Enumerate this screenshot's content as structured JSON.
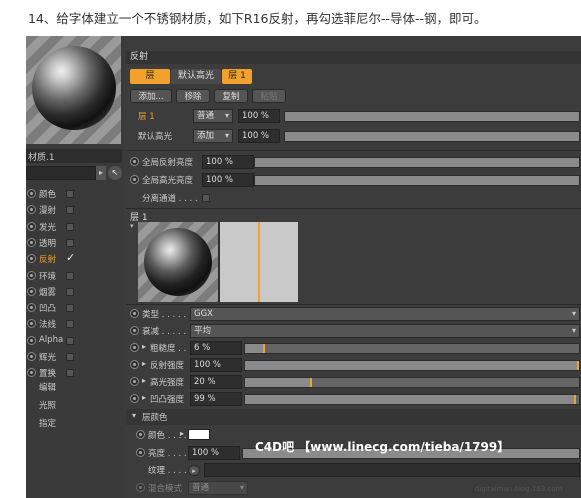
{
  "caption": "14、给字体建立一个不锈钢材质，如下R16反射，再勾选菲尼尔--导体--钢，即可。",
  "material_name": "材质.1",
  "channels": [
    {
      "label": "颜色",
      "active": false
    },
    {
      "label": "漫射",
      "active": false
    },
    {
      "label": "发光",
      "active": false
    },
    {
      "label": "透明",
      "active": false
    },
    {
      "label": "反射",
      "active": true
    },
    {
      "label": "环境",
      "active": false
    },
    {
      "label": "烟雾",
      "active": false
    },
    {
      "label": "凹凸",
      "active": false
    },
    {
      "label": "法线",
      "active": false
    },
    {
      "label": "Alpha",
      "active": false
    },
    {
      "label": "辉光",
      "active": false
    },
    {
      "label": "置换",
      "active": false
    }
  ],
  "extra_items": [
    "编辑",
    "光照",
    "指定"
  ],
  "section_title": "反射",
  "tabs": [
    "层",
    "默认高光",
    "层 1"
  ],
  "buttons": {
    "add": "添加...",
    "remove": "移除",
    "copy": "复制",
    "paste": "粘贴"
  },
  "layers": [
    {
      "name": "层 1",
      "mode": "普通",
      "value": "100 %"
    },
    {
      "name": "默认高光",
      "mode": "添加",
      "value": "100 %"
    }
  ],
  "global_reflect": {
    "label": "全局反射亮度",
    "value": "100 %"
  },
  "global_spec": {
    "label": "全局高光亮度",
    "value": "100 %"
  },
  "separate": {
    "label": "分离通道 . . . ."
  },
  "layer_title": "层 1",
  "type": {
    "label": "类型 . . . . .",
    "value": "GGX"
  },
  "falloff": {
    "label": "衰减 . . . . .",
    "value": "平均"
  },
  "roughness": {
    "label": "粗糙度 . .",
    "value": "6 %",
    "level": 0.06
  },
  "reflect_strength": {
    "label": "反射强度",
    "value": "100 %",
    "level": 1.0
  },
  "spec_strength": {
    "label": "高光强度",
    "value": "20 %",
    "level": 0.2
  },
  "bump_strength": {
    "label": "凹凸强度",
    "value": "99 %",
    "level": 0.99
  },
  "layer_color_title": "层颜色",
  "color_label": "颜色 . . . . .",
  "brightness": {
    "label": "亮度 . . . . .",
    "value": "100 %"
  },
  "texture_label": "纹理 . . . . .",
  "blend_mode": {
    "label": "混合模式",
    "value": "普通"
  },
  "watermark": "C4D吧 【www.linecg.com/tieba/1799】",
  "site": "digitalman.blog.163.com",
  "colors": {
    "accent": "#f2a22c",
    "panel": "#3c3c3c"
  }
}
